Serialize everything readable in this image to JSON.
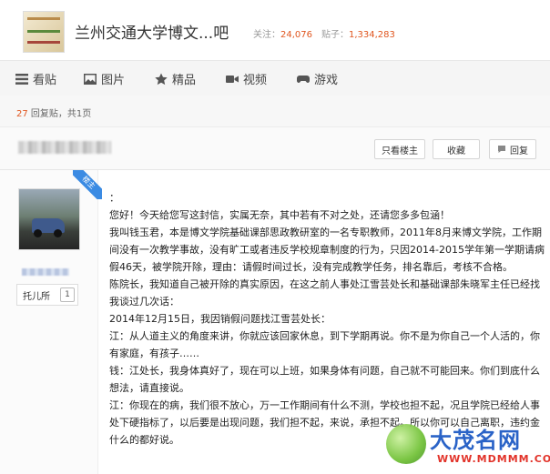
{
  "forum": {
    "title": "兰州交通大学博文...吧",
    "follow_label": "关注：",
    "follow_count": "24,076",
    "posts_label": "贴子：",
    "posts_count": "1,334,283"
  },
  "nav": [
    {
      "label": "看贴",
      "icon": "list-icon"
    },
    {
      "label": "图片",
      "icon": "image-icon"
    },
    {
      "label": "精品",
      "icon": "star-icon"
    },
    {
      "label": "视频",
      "icon": "video-icon"
    },
    {
      "label": "游戏",
      "icon": "gamepad-icon"
    }
  ],
  "thread_meta": {
    "reply_count": "27",
    "reply_text": " 回复贴，共1页"
  },
  "post_actions": {
    "only_op": "只看楼主",
    "favorite": "收藏",
    "reply": "回复"
  },
  "author": {
    "ribbon": "楼主",
    "level_name": "托儿所",
    "level_badge": "1"
  },
  "post": {
    "lines": [
      "：",
      "您好！今天给您写这封信，实属无奈，其中若有不对之处，还请您多多包涵！",
      "我叫钱玉君，本是博文学院基础课部思政教研室的一名专职教师，2011年8月来博文学院，工作期间没有一次教学事故，没有旷工或者违反学校规章制度的行为，只因2014-2015学年第一学期请病假46天，被学院开除，理由：请假时间过长，没有完成教学任务，排名靠后，考核不合格。",
      "陈院长，我知道自己被开除的真实原因，在这之前人事处江雪芸处长和基础课部朱晓军主任已经找我谈过几次话：",
      "2014年12月15日，我因销假问题找江雪芸处长：",
      "江：从人道主义的角度来讲，你就应该回家休息，到下学期再说。你不是为你自己一个人活的，你有家庭，有孩子……",
      "钱：江处长，我身体真好了，现在可以上班，如果身体有问题，自己就不可能回来。你们到底什么想法，请直接说。",
      "江：你现在的病，我们很不放心，万一工作期间有什么不测，学校也担不起，况且学院已经给人事处下硬指标了，以后要是出现问题，我们担不起，来说，承担不起。所以你可以自己离职，违约金什么的都好说。"
    ]
  },
  "watermark": {
    "main": "大茂名网",
    "url": "WWW.MDMMM.COM"
  }
}
